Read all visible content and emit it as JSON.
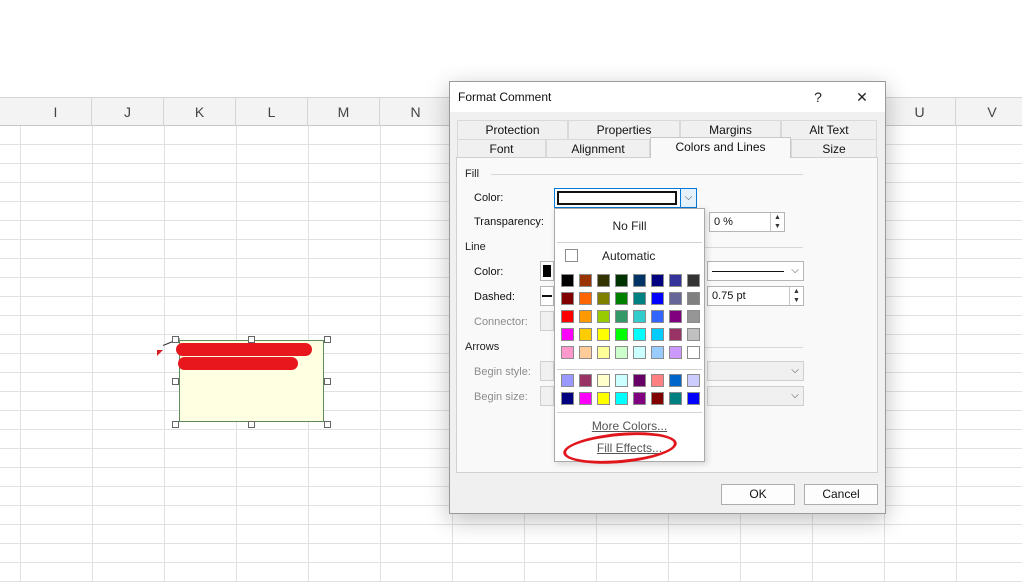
{
  "spreadsheet": {
    "columns": [
      "I",
      "J",
      "K",
      "L",
      "M",
      "N",
      "U",
      "V"
    ]
  },
  "dialog": {
    "title": "Format Comment",
    "help_label": "?",
    "close_label": "✕",
    "tabs_row1": [
      "Protection",
      "Properties",
      "Margins",
      "Alt Text"
    ],
    "tabs_row2": [
      "Font",
      "Alignment",
      "Colors and Lines",
      "Size"
    ],
    "active_tab": "Colors and Lines",
    "fill": {
      "section": "Fill",
      "color_label": "Color:",
      "transparency_label": "Transparency:",
      "transparency_value": "0 %"
    },
    "line": {
      "section": "Line",
      "color_label": "Color:",
      "dashed_label": "Dashed:",
      "connector_label": "Connector:",
      "weight_value": "0.75 pt"
    },
    "arrows": {
      "section": "Arrows",
      "begin_style_label": "Begin style:",
      "begin_size_label": "Begin size:"
    },
    "ok_label": "OK",
    "cancel_label": "Cancel"
  },
  "picker": {
    "no_fill": "No Fill",
    "automatic": "Automatic",
    "more_colors": "More Colors...",
    "fill_effects": "Fill Effects...",
    "colors_main": [
      [
        "#000000",
        "#993300",
        "#333300",
        "#003300",
        "#003366",
        "#000080",
        "#333399",
        "#333333"
      ],
      [
        "#800000",
        "#ff6600",
        "#808000",
        "#008000",
        "#008080",
        "#0000ff",
        "#666699",
        "#808080"
      ],
      [
        "#ff0000",
        "#ff9900",
        "#99cc00",
        "#339966",
        "#33cccc",
        "#3366ff",
        "#800080",
        "#969696"
      ],
      [
        "#ff00ff",
        "#ffcc00",
        "#ffff00",
        "#00ff00",
        "#00ffff",
        "#00ccff",
        "#993366",
        "#c0c0c0"
      ],
      [
        "#ff99cc",
        "#ffcc99",
        "#ffff99",
        "#ccffcc",
        "#ccffff",
        "#99ccff",
        "#cc99ff",
        "#ffffff"
      ]
    ],
    "colors_extra": [
      [
        "#9999ff",
        "#993366",
        "#ffffcc",
        "#ccffff",
        "#660066",
        "#ff8080",
        "#0066cc",
        "#ccccff"
      ],
      [
        "#000080",
        "#ff00ff",
        "#ffff00",
        "#00ffff",
        "#800080",
        "#800000",
        "#008080",
        "#0000ff"
      ]
    ]
  },
  "colors": {
    "accent": "#0078d7",
    "annotation_red": "#e0161c",
    "comment_fill": "#ffffe1"
  }
}
